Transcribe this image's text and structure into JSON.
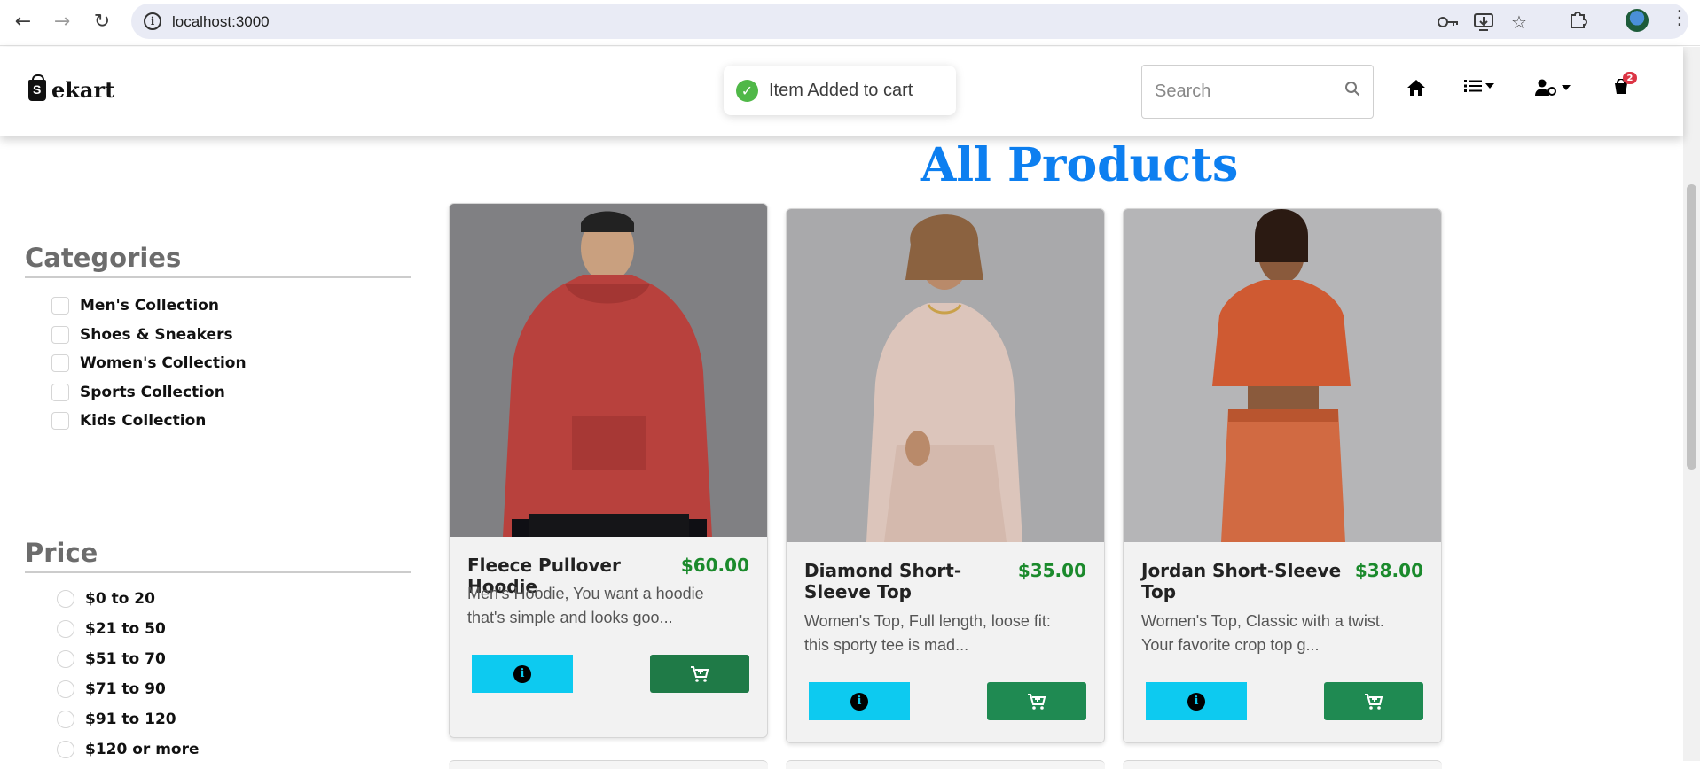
{
  "browser": {
    "url": "localhost:3000"
  },
  "header": {
    "brand": "ekart",
    "toast_message": "Item Added to cart",
    "search_placeholder": "Search",
    "cart_count": "2"
  },
  "sidebar": {
    "categories_title": "Categories",
    "categories": [
      {
        "label": "Men's Collection"
      },
      {
        "label": "Shoes & Sneakers"
      },
      {
        "label": "Women's Collection"
      },
      {
        "label": "Sports Collection"
      },
      {
        "label": "Kids Collection"
      }
    ],
    "price_title": "Price",
    "prices": [
      {
        "label": "$0 to 20"
      },
      {
        "label": "$21 to 50"
      },
      {
        "label": "$51 to 70"
      },
      {
        "label": "$71 to 90"
      },
      {
        "label": "$91 to 120"
      },
      {
        "label": "$120 or more"
      }
    ]
  },
  "main": {
    "title": "All Products",
    "products": [
      {
        "name": "Fleece Pullover Hoodie",
        "price": "$60.00",
        "description": "Men's Hoodie, You want a hoodie that's simple and looks goo..."
      },
      {
        "name": "Diamond Short-Sleeve Top",
        "price": "$35.00",
        "description": "Women's Top, Full length, loose fit: this sporty tee is mad..."
      },
      {
        "name": "Jordan Short-Sleeve Top",
        "price": "$38.00",
        "description": "Women's Top, Classic with a twist. Your favorite crop top g..."
      }
    ]
  },
  "colors": {
    "accent_blue": "#0d7ff0",
    "price_green": "#1b8a2c",
    "info_button": "#0dcaf0",
    "cart_button": "#1f7a47",
    "badge_red": "#dc3545"
  }
}
